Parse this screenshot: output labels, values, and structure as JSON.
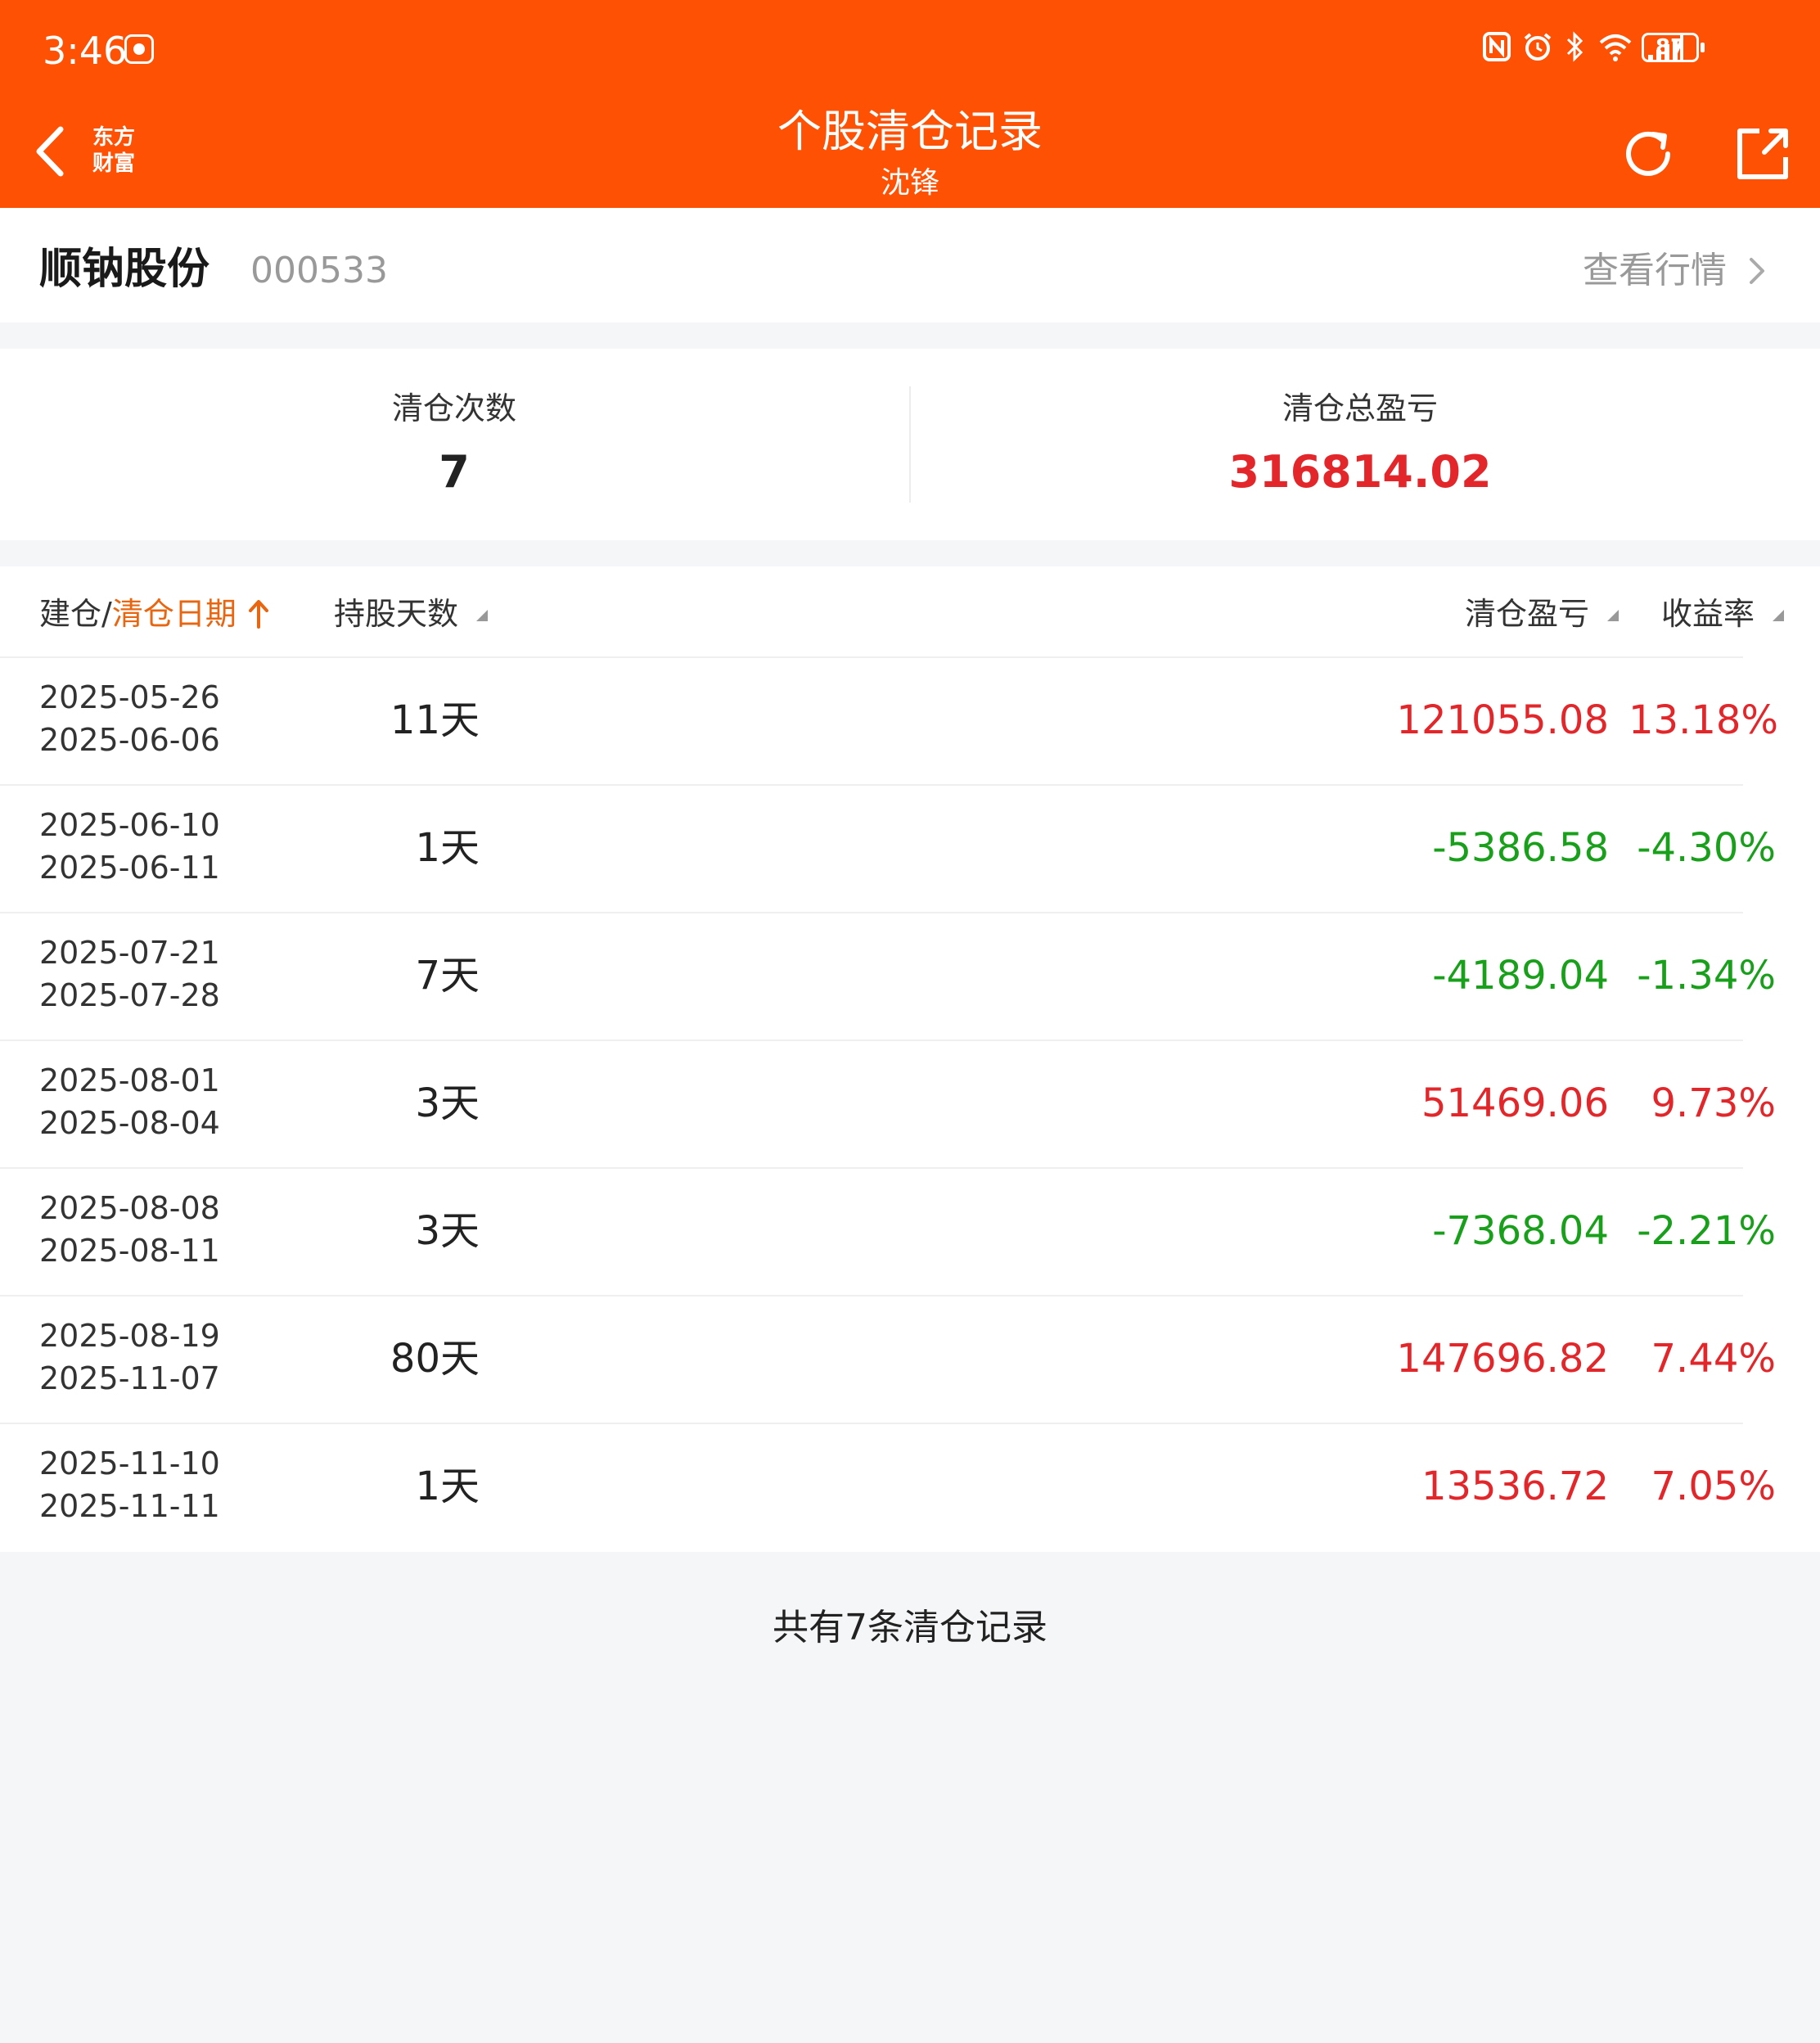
{
  "status_bar": {
    "time": "3:46",
    "battery": "87",
    "icons": [
      "nfc-icon",
      "alarm-icon",
      "bluetooth-icon",
      "wifi-icon",
      "signal-icon",
      "battery-icon"
    ]
  },
  "header": {
    "title": "个股清仓记录",
    "subtitle": "沈锋",
    "logo_line1": "东方",
    "logo_line2": "财富",
    "color": "#fe5104"
  },
  "stock": {
    "name": "顺钠股份",
    "code": "000533",
    "quote_link": "查看行情"
  },
  "summary": {
    "count_label": "清仓次数",
    "count_value": "7",
    "total_label": "清仓总盈亏",
    "total_value": "316814.02"
  },
  "table": {
    "headers": {
      "date_prefix": "建仓/",
      "date_active": "清仓日期",
      "days": "持股天数",
      "pnl": "清仓盈亏",
      "rate": "收益率"
    },
    "rows": [
      {
        "open": "2025-05-26",
        "close": "2025-06-06",
        "days": "11天",
        "pnl": "121055.08",
        "rate": "13.18%",
        "trend": "up"
      },
      {
        "open": "2025-06-10",
        "close": "2025-06-11",
        "days": "1天",
        "pnl": "-5386.58",
        "rate": "-4.30%",
        "trend": "down"
      },
      {
        "open": "2025-07-21",
        "close": "2025-07-28",
        "days": "7天",
        "pnl": "-4189.04",
        "rate": "-1.34%",
        "trend": "down"
      },
      {
        "open": "2025-08-01",
        "close": "2025-08-04",
        "days": "3天",
        "pnl": "51469.06",
        "rate": "9.73%",
        "trend": "up"
      },
      {
        "open": "2025-08-08",
        "close": "2025-08-11",
        "days": "3天",
        "pnl": "-7368.04",
        "rate": "-2.21%",
        "trend": "down"
      },
      {
        "open": "2025-08-19",
        "close": "2025-11-07",
        "days": "80天",
        "pnl": "147696.82",
        "rate": "7.44%",
        "trend": "up"
      },
      {
        "open": "2025-11-10",
        "close": "2025-11-11",
        "days": "1天",
        "pnl": "13536.72",
        "rate": "7.05%",
        "trend": "up"
      }
    ]
  },
  "footer": {
    "note": "共有7条清仓记录"
  },
  "colors": {
    "up": "#e3262a",
    "down": "#19a01b",
    "accent": "#e9650f"
  }
}
